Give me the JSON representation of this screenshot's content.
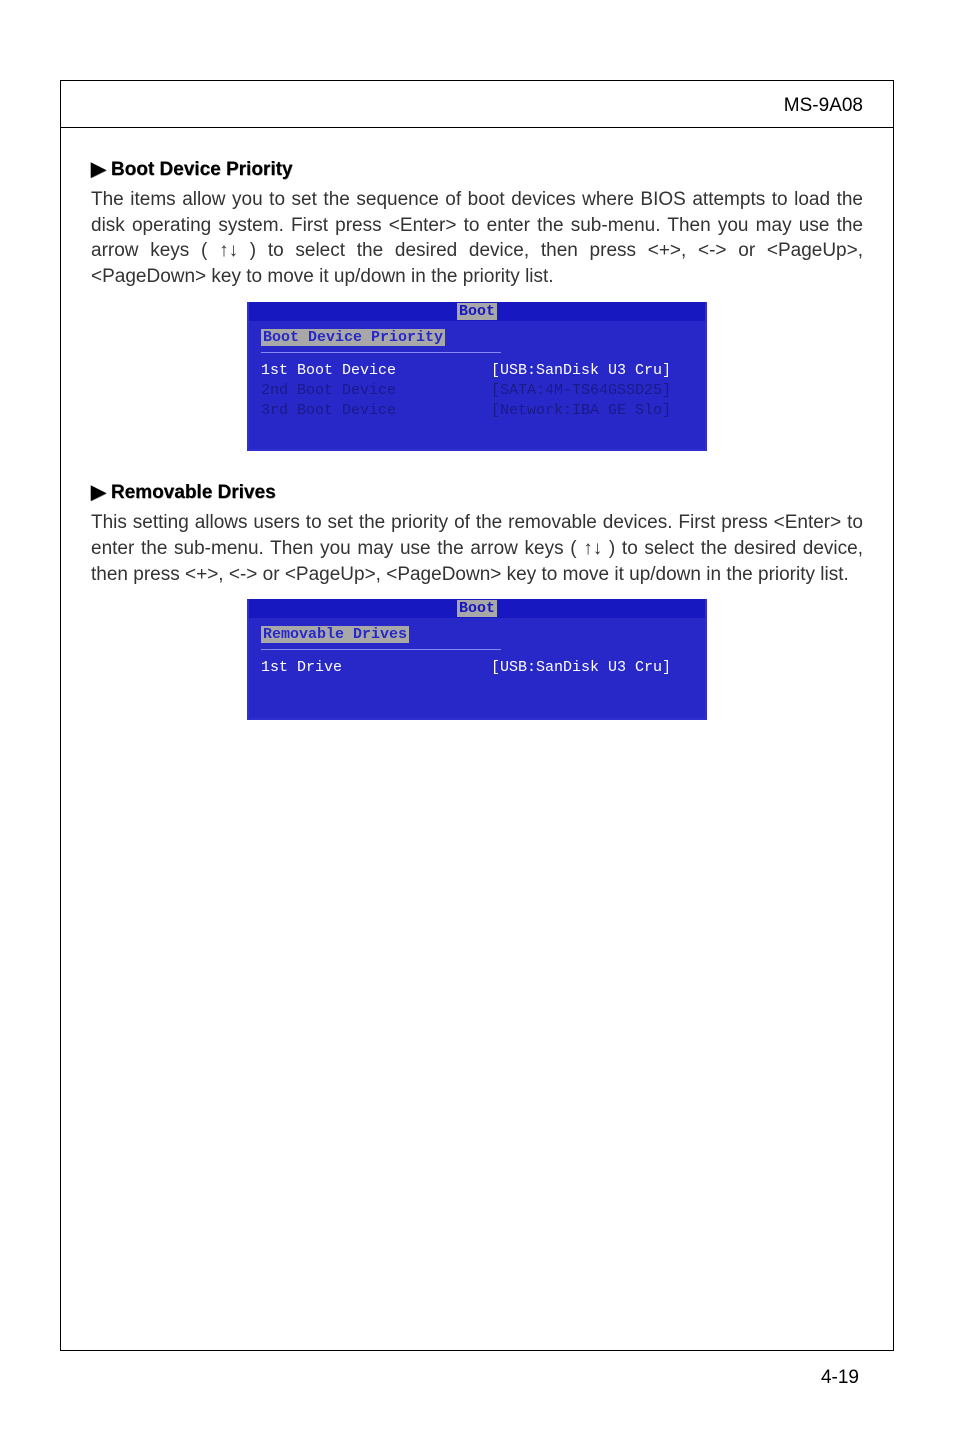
{
  "header": {
    "model": "MS-9A08"
  },
  "section1": {
    "heading": "▶ Boot Device Priority",
    "text": "The items allow you to set the sequence of boot devices where BIOS attempts to load the disk operating system. First press <Enter> to enter the sub-menu. Then you may use the arrow keys ( ↑↓ ) to select the desired device, then press <+>, <-> or <PageUp>, <PageDown> key to move it up/down in the priority list."
  },
  "bios1": {
    "title": "Boot",
    "subtitle": "Boot Device Priority",
    "rows": [
      {
        "label": "1st Boot Device",
        "value": "[USB:SanDisk U3 Cru]",
        "selected": true
      },
      {
        "label": "2nd Boot Device",
        "value": "[SATA:4M-TS64GSSD25]",
        "selected": false
      },
      {
        "label": "3rd Boot Device",
        "value": "[Network:IBA GE Slo]",
        "selected": false
      }
    ]
  },
  "section2": {
    "heading": "▶ Removable Drives",
    "text": "This setting allows users to set the priority of the removable devices. First press <Enter> to enter the sub-menu. Then you may use the arrow keys ( ↑↓ ) to select the desired device, then press <+>, <-> or <PageUp>, <PageDown> key to move it up/down in the priority list."
  },
  "bios2": {
    "title": "Boot",
    "subtitle": "Removable Drives",
    "rows": [
      {
        "label": "1st Drive",
        "value": "[USB:SanDisk U3 Cru]",
        "selected": true
      }
    ]
  },
  "footer": {
    "page": "4-19"
  }
}
